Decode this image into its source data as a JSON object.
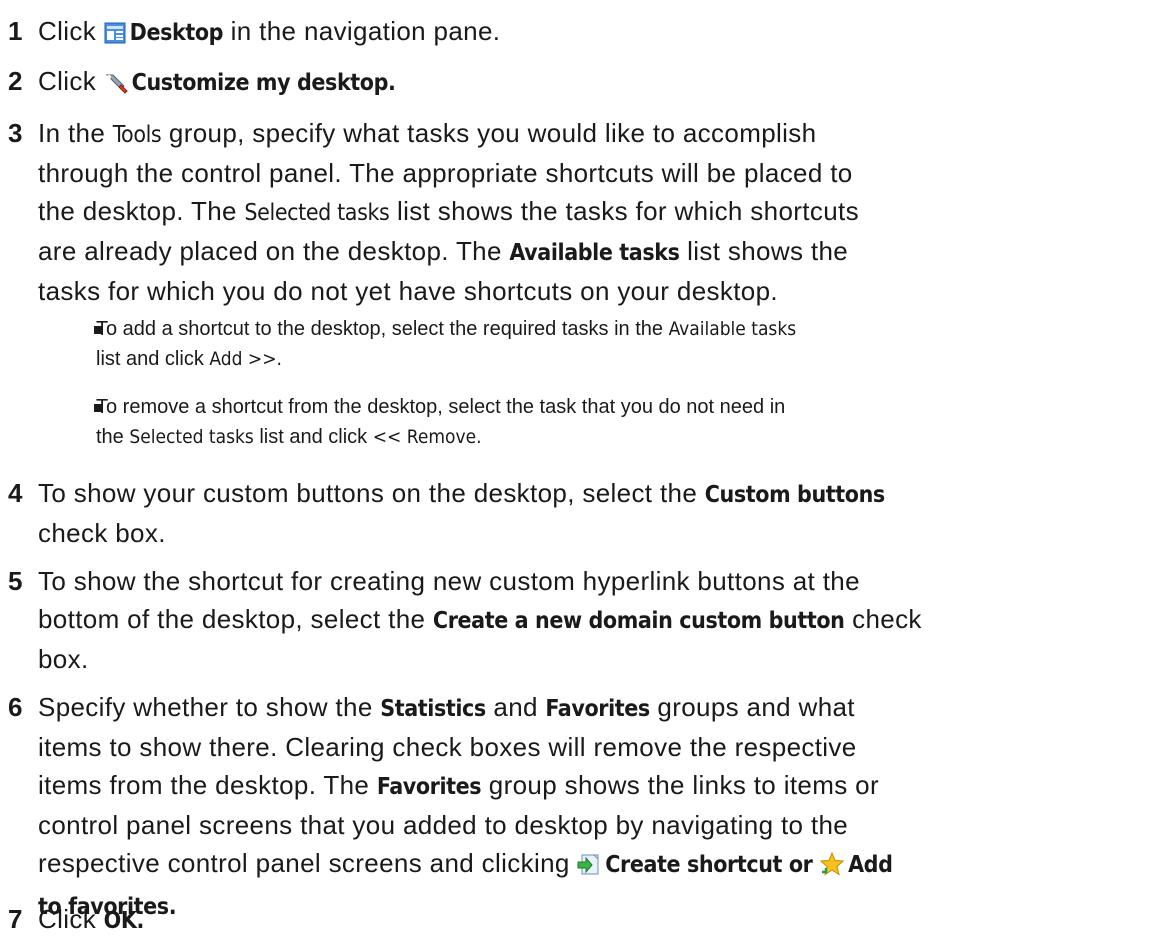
{
  "steps": [
    {
      "num": "1",
      "parts": [
        "Click ",
        "Desktop",
        " in the navigation pane."
      ]
    },
    {
      "num": "2",
      "parts": [
        "Click ",
        "Customize my desktop."
      ]
    },
    {
      "num": "3",
      "lines": [
        [
          "In the ",
          "Tools",
          " group, specify what tasks you would like to accomplish"
        ],
        [
          "through the control panel. The appropriate shortcuts will be placed to"
        ],
        [
          "the desktop. The ",
          "Selected tasks",
          " list shows the tasks for which shortcuts"
        ],
        [
          "are already placed on the desktop. The ",
          "Available tasks",
          " list shows the"
        ],
        [
          "tasks for which you do not yet have shortcuts on your desktop."
        ]
      ]
    },
    {
      "num": "4",
      "lines": [
        [
          "To show your custom buttons on the desktop, select the ",
          "Custom buttons"
        ],
        [
          "check box."
        ]
      ]
    },
    {
      "num": "5",
      "lines": [
        [
          "To show the shortcut for creating new custom hyperlink buttons at the"
        ],
        [
          "bottom of the desktop, select the ",
          "Create a new domain custom button",
          " check"
        ],
        [
          "box."
        ]
      ]
    },
    {
      "num": "6",
      "lines": [
        [
          "Specify whether to show the ",
          "Statistics",
          " and ",
          "Favorites",
          " groups and what"
        ],
        [
          "items to show there. Clearing check boxes will remove the respective"
        ],
        [
          "items from the desktop. The ",
          "Favorites",
          " group shows the links to items or"
        ],
        [
          "control panel screens that you added to desktop by navigating to the"
        ],
        [
          "respective control panel screens and clicking ",
          "Create shortcut or",
          "Add"
        ],
        [
          "to favorites."
        ]
      ]
    },
    {
      "num": "7",
      "parts": [
        "Click ",
        "OK."
      ]
    }
  ],
  "bullets": [
    {
      "lines": [
        [
          "To add a shortcut to the desktop, select the required tasks in the ",
          "Available tasks"
        ],
        [
          "list and click ",
          "Add >>."
        ]
      ]
    },
    {
      "lines": [
        [
          "To remove a shortcut from the desktop, select the task that you do not need in"
        ],
        [
          "the ",
          "Selected tasks",
          " list and click ",
          "<< Remove."
        ]
      ]
    }
  ],
  "icons": {
    "desktop": "desktop-icon",
    "customize": "wrench-icon",
    "shortcut": "create-shortcut-icon",
    "favorites": "star-icon"
  }
}
